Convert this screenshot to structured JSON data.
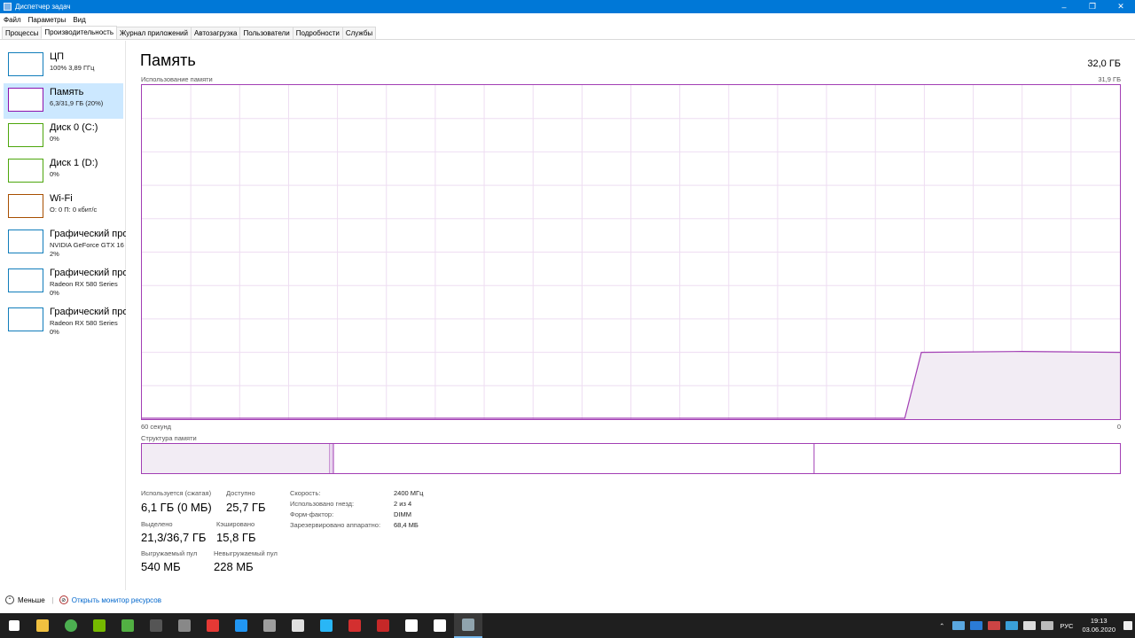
{
  "window": {
    "title": "Диспетчер задач",
    "minimize": "–",
    "maximize": "❐",
    "close": "✕"
  },
  "menu": [
    "Файл",
    "Параметры",
    "Вид"
  ],
  "tabs": [
    "Процессы",
    "Производительность",
    "Журнал приложений",
    "Автозагрузка",
    "Пользователи",
    "Подробности",
    "Службы"
  ],
  "active_tab": 1,
  "sidebar": [
    {
      "name": "ЦП",
      "sub": [
        "100% 3,89 ГГц"
      ],
      "color": "#117dbb",
      "active": false
    },
    {
      "name": "Память",
      "sub": [
        "6,3/31,9 ГБ (20%)"
      ],
      "color": "#8b12ae",
      "active": true
    },
    {
      "name": "Диск 0 (C:)",
      "sub": [
        "0%"
      ],
      "color": "#4da60c",
      "active": false
    },
    {
      "name": "Диск 1 (D:)",
      "sub": [
        "0%"
      ],
      "color": "#4da60c",
      "active": false
    },
    {
      "name": "Wi-Fi",
      "sub": [
        "О: 0 П: 0 кбит/с"
      ],
      "color": "#a74f01",
      "active": false
    },
    {
      "name": "Графический про",
      "sub": [
        "NVIDIA GeForce GTX 16",
        "2%"
      ],
      "color": "#117dbb",
      "active": false
    },
    {
      "name": "Графический про",
      "sub": [
        "Radeon RX 580 Series",
        "0%"
      ],
      "color": "#117dbb",
      "active": false
    },
    {
      "name": "Графический про",
      "sub": [
        "Radeon RX 580 Series",
        "0%"
      ],
      "color": "#117dbb",
      "active": false
    }
  ],
  "main": {
    "title": "Память",
    "total": "32,0 ГБ",
    "graph_label": "Использование памяти",
    "graph_max": "31,9 ГБ",
    "time_label": "60 секунд",
    "time_end": "0",
    "struct_label": "Структура памяти",
    "accent": "#a23eb4",
    "usage_fraction": 0.2
  },
  "stats": {
    "in_use_label": "Используется (сжатая)",
    "in_use": "6,1 ГБ (0 МБ)",
    "available_label": "Доступно",
    "available": "25,7 ГБ",
    "committed_label": "Выделено",
    "committed": "21,3/36,7 ГБ",
    "cached_label": "Кэшировано",
    "cached": "15,8 ГБ",
    "paged_label": "Выгружаемый пул",
    "paged": "540 МБ",
    "nonpaged_label": "Невыгружаемый пул",
    "nonpaged": "228 МБ"
  },
  "specs": [
    {
      "label": "Скорость:",
      "value": "2400 МГц"
    },
    {
      "label": "Использовано гнезд:",
      "value": "2 из 4"
    },
    {
      "label": "Форм-фактор:",
      "value": "DIMM"
    },
    {
      "label": "Зарезервировано аппаратно:",
      "value": "68,4 МБ"
    }
  ],
  "footer": {
    "less": "Меньше",
    "monitor": "Открыть монитор ресурсов"
  },
  "taskbar": {
    "icons": [
      "windows-start-icon",
      "file-explorer-icon",
      "chrome-icon",
      "nvidia-icon",
      "xbox-icon",
      "epic-games-icon",
      "calculator-icon",
      "medical-icon",
      "teamviewer-icon",
      "document-icon",
      "game-icon",
      "app-icon",
      "adobe-icon",
      "red-app-icon",
      "notepad-icon",
      "editor-icon",
      "task-manager-icon"
    ],
    "lang": "РУС",
    "time": "19:13",
    "date": "03.06.2020"
  }
}
